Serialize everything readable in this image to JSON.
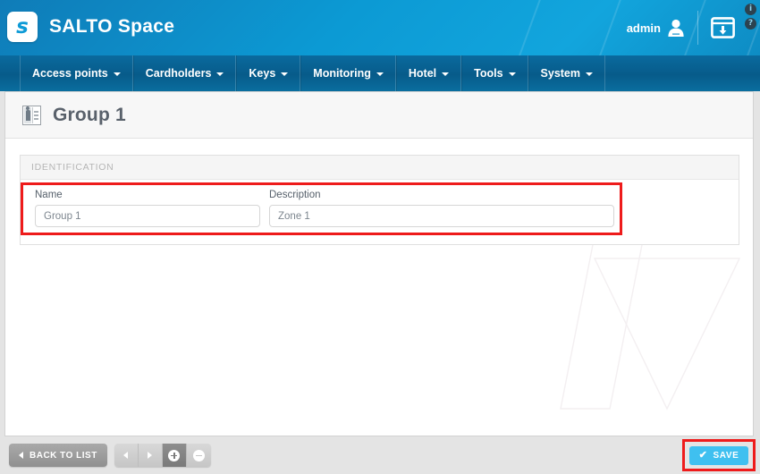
{
  "header": {
    "brand": "SALTO Space",
    "logo_letter": "s",
    "logo_icon": "salto-s-logo-icon",
    "admin_label": "admin",
    "user_icon": "user-avatar-icon",
    "window_icon": "download-window-icon",
    "info_icon": "info-circle-icon",
    "help_icon": "help-circle-icon",
    "info_glyph": "i",
    "help_glyph": "?",
    "accent_color": "#0d9ad6"
  },
  "nav": {
    "items": [
      {
        "label": "Access points",
        "caret": true
      },
      {
        "label": "Cardholders",
        "caret": true
      },
      {
        "label": "Keys",
        "caret": true
      },
      {
        "label": "Monitoring",
        "caret": true
      },
      {
        "label": "Hotel",
        "caret": true
      },
      {
        "label": "Tools",
        "caret": true
      },
      {
        "label": "System",
        "caret": true
      }
    ]
  },
  "page": {
    "title": "Group 1",
    "title_icon": "group-zone-icon"
  },
  "identification": {
    "section_header": "IDENTIFICATION",
    "fields": [
      {
        "label": "Name",
        "value": "Group 1",
        "placeholder": "",
        "name": "name-input"
      },
      {
        "label": "Description",
        "value": "Zone 1",
        "placeholder": "",
        "name": "description-input"
      }
    ],
    "highlight_color": "#ee1b1b"
  },
  "footer": {
    "back_label": "BACK TO LIST",
    "back_icon": "chevron-left-icon",
    "prev_icon": "chevron-left-icon",
    "next_icon": "chevron-right-icon",
    "add_icon": "plus-circle-icon",
    "remove_icon": "minus-circle-icon",
    "save_label": "SAVE",
    "save_icon": "check-icon",
    "save_check_glyph": "✔",
    "save_color": "#3fc0f0",
    "highlight_color": "#ee1b1b"
  }
}
